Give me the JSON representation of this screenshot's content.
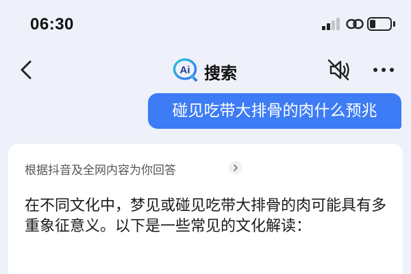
{
  "status_bar": {
    "time": "06:30",
    "battery_level": 0.3
  },
  "nav": {
    "logo_text": "Ai",
    "title": "搜索",
    "icons": [
      "back-icon",
      "mute-icon",
      "more-icon"
    ]
  },
  "query": {
    "text": "碰见吃带大排骨的肉什么预兆"
  },
  "answer": {
    "source": "根据抖音及全网内容为你回答",
    "paragraph": "在不同文化中，梦见或碰见吃带大排骨的肉可能具有多重象征意义。以下是一些常见的文化解读："
  },
  "colors": {
    "accent": "#3d7cf5",
    "background": "#eef1f9",
    "card": "#ffffff"
  }
}
